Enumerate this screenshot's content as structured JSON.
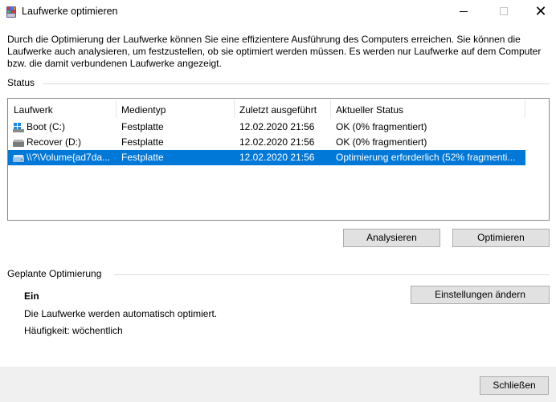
{
  "window": {
    "title": "Laufwerke optimieren",
    "minimize_glyph": "—",
    "maximize_glyph": "☐",
    "close_glyph": "✕"
  },
  "description": "Durch die Optimierung der Laufwerke können Sie eine effizientere Ausführung des Computers erreichen. Sie können die Laufwerke auch analysieren, um festzustellen, ob sie optimiert werden müssen. Es werden nur Laufwerke auf dem Computer bzw. die damit verbundenen Laufwerke angezeigt.",
  "status": {
    "label": "Status",
    "columns": [
      "Laufwerk",
      "Medientyp",
      "Zuletzt ausgeführt",
      "Aktueller Status"
    ],
    "rows": [
      {
        "drive": "Boot (C:)",
        "media": "Festplatte",
        "last_run": "12.02.2020 21:56",
        "status": "OK (0% fragmentiert)",
        "icon": "windows-drive-icon",
        "selected": false
      },
      {
        "drive": "Recover (D:)",
        "media": "Festplatte",
        "last_run": "12.02.2020 21:56",
        "status": "OK (0% fragmentiert)",
        "icon": "hard-drive-icon",
        "selected": false
      },
      {
        "drive": "\\\\?\\Volume{ad7da...",
        "media": "Festplatte",
        "last_run": "12.02.2020 21:56",
        "status": "Optimierung erforderlich (52% fragmenti...",
        "icon": "hard-drive-icon",
        "selected": true
      }
    ],
    "analyze_label": "Analysieren",
    "optimize_label": "Optimieren"
  },
  "schedule": {
    "label": "Geplante Optimierung",
    "state": "Ein",
    "info": "Die Laufwerke werden automatisch optimiert.",
    "frequency": "Häufigkeit: wöchentlich",
    "change_settings_label": "Einstellungen ändern"
  },
  "footer": {
    "close_label": "Schließen"
  },
  "colors": {
    "selection": "#0078d7",
    "button_face": "#e1e1e1",
    "footer_bg": "#f0f0f0"
  }
}
